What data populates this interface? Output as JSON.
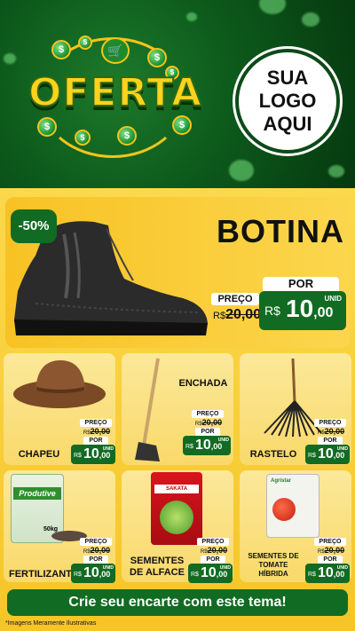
{
  "header": {
    "title": "OFERTA",
    "logo_lines": [
      "SUA",
      "LOGO",
      "AQUI"
    ],
    "coin_symbol": "$",
    "cart_icon": "shopping-cart-icon"
  },
  "colors": {
    "brand_green": "#116b22",
    "header_green": "#0d5a1c",
    "accent_yellow": "#ffd21e",
    "panel_yellow": "#f8c224"
  },
  "hero": {
    "discount": "-50%",
    "name": "BOTINA",
    "price_label": "PREÇO",
    "old_prefix": "R$",
    "old_price": "20,00",
    "por_label": "POR",
    "currency": "R$",
    "price_int": "10",
    "price_dec": ",00",
    "unit": "UNID"
  },
  "products": [
    {
      "name": "CHAPEU",
      "price_label": "PREÇO",
      "old_prefix": "R$",
      "old_price": "20,00",
      "por_label": "POR",
      "currency": "R$",
      "price_int": "10",
      "price_dec": ",00",
      "unit": "UNID"
    },
    {
      "name": "ENCHADA",
      "price_label": "PREÇO",
      "old_prefix": "R$",
      "old_price": "20,00",
      "por_label": "POR",
      "currency": "R$",
      "price_int": "10",
      "price_dec": ",00",
      "unit": "UNID"
    },
    {
      "name": "RASTELO",
      "price_label": "PREÇO",
      "old_prefix": "R$",
      "old_price": "20,00",
      "por_label": "POR",
      "currency": "R$",
      "price_int": "10",
      "price_dec": ",00",
      "unit": "UNID"
    },
    {
      "name": "FERTILIZANTES",
      "price_label": "PREÇO",
      "old_prefix": "R$",
      "old_price": "20,00",
      "por_label": "POR",
      "currency": "R$",
      "price_int": "10",
      "price_dec": ",00",
      "unit": "UNID",
      "bag_brand": "Produtive",
      "bag_weight": "50kg"
    },
    {
      "name_lines": [
        "SEMENTES",
        "DE ALFACE"
      ],
      "price_label": "PREÇO",
      "old_prefix": "R$",
      "old_price": "20,00",
      "por_label": "POR",
      "currency": "R$",
      "price_int": "10",
      "price_dec": ",00",
      "unit": "UNID",
      "pack_brand": "SAKATA"
    },
    {
      "name_lines": [
        "SEMENTES DE",
        "TOMATE",
        "HÍBRIDA"
      ],
      "price_label": "PREÇO",
      "old_prefix": "R$",
      "old_price": "20,00",
      "por_label": "POR",
      "currency": "R$",
      "price_int": "10",
      "price_dec": ",00",
      "unit": "UNID",
      "pack_brand": "Agristar"
    }
  ],
  "cta": "Crie seu encarte com este tema!",
  "disclaimer": "*Imagens Meramente Ilustrativas"
}
